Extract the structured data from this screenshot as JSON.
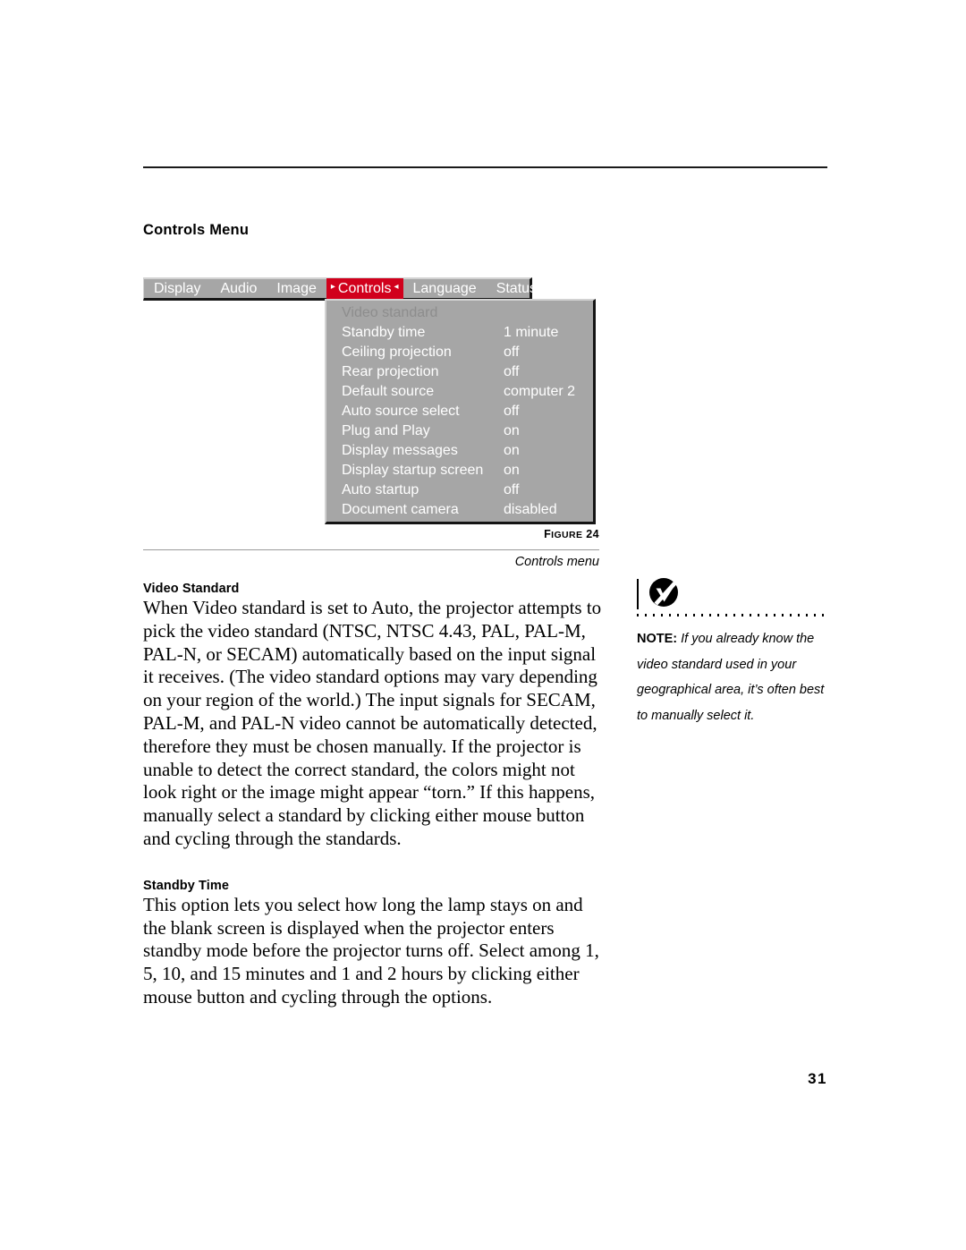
{
  "page": {
    "number": "31",
    "section_heading": "Controls Menu"
  },
  "osd": {
    "menubar": {
      "tabs": [
        {
          "label": "Display",
          "active": false
        },
        {
          "label": "Audio",
          "active": false
        },
        {
          "label": "Image",
          "active": false
        },
        {
          "label": "Controls",
          "active": true
        },
        {
          "label": "Language",
          "active": false
        },
        {
          "label": "Status",
          "active": false
        }
      ],
      "active_tab_left_arrow": "▸",
      "active_tab_right_arrow": "◂"
    },
    "dropdown": {
      "rows": [
        {
          "label": "Video standard",
          "value": "",
          "disabled": true
        },
        {
          "label": "Standby time",
          "value": "1 minute",
          "disabled": false
        },
        {
          "label": "Ceiling projection",
          "value": "off",
          "disabled": false
        },
        {
          "label": "Rear projection",
          "value": "off",
          "disabled": false
        },
        {
          "label": "Default source",
          "value": "computer 2",
          "disabled": false
        },
        {
          "label": "Auto source select",
          "value": "off",
          "disabled": false
        },
        {
          "label": "Plug and Play",
          "value": "on",
          "disabled": false
        },
        {
          "label": "Display messages",
          "value": "on",
          "disabled": false
        },
        {
          "label": "Display startup screen",
          "value": "on",
          "disabled": false
        },
        {
          "label": "Auto startup",
          "value": "off",
          "disabled": false
        },
        {
          "label": "Document camera",
          "value": "disabled",
          "disabled": false
        }
      ]
    },
    "colors": {
      "menu_background": "#a6a6a6",
      "active_tab_background": "#d1001c",
      "menu_text": "#ffffff",
      "disabled_text": "#8d8d8d",
      "bevel_light": "#d2d2d2",
      "bevel_dark": "#141414"
    }
  },
  "figure": {
    "label_prefix": "F",
    "label_rest": "IGURE",
    "number": "24",
    "caption": "Controls menu"
  },
  "body": {
    "video_standard": {
      "heading": "Video Standard",
      "paragraph": "When Video standard is set to Auto, the projector attempts to pick the video standard (NTSC, NTSC 4.43, PAL, PAL-M, PAL-N, or SECAM) automatically based on the input signal it receives. (The video standard options may vary depending on your region of the world.) The input signals for SECAM, PAL-M, and PAL-N video cannot be automatically detected, therefore they must be chosen manually. If the projector is unable to detect the correct standard, the colors might not look right or the image might appear “torn.” If this happens, manually select a standard by clicking either mouse button and cycling through the standards."
    },
    "standby_time": {
      "heading": "Standby Time",
      "paragraph": "This option lets you select how long the lamp stays on and the blank screen is displayed when the projector enters standby mode before the projector turns off. Select among 1, 5, 10, and 15 minutes and 1 and 2 hours by clicking either mouse button and cycling through the options."
    }
  },
  "note": {
    "icon": "note-logo-icon",
    "prefix": "NOTE:",
    "text": " If you already know the video standard used in your geographical area, it’s often best to manually select it."
  }
}
